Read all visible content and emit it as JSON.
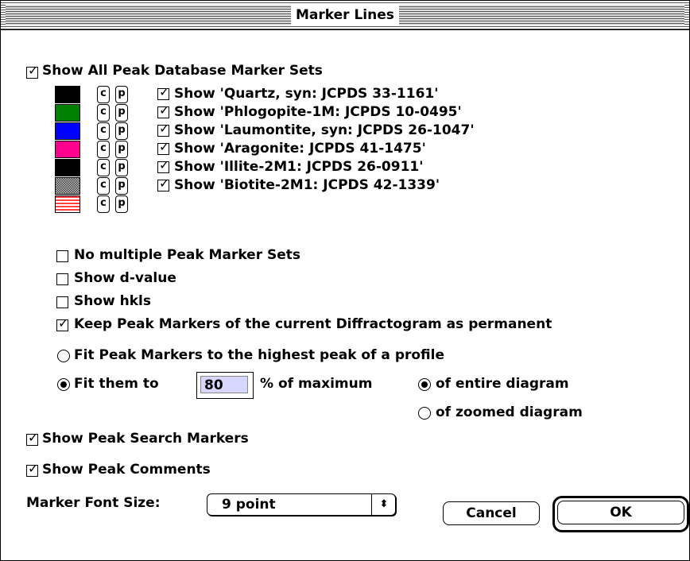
{
  "window": {
    "title": "Marker Lines"
  },
  "show_all": {
    "label": "Show All Peak Database Marker Sets",
    "checked": true
  },
  "marker_sets": [
    {
      "color": "#000000",
      "pattern": "solid",
      "checked": true,
      "label": "Show 'Quartz, syn: JCPDS 33-1161'"
    },
    {
      "color": "#008000",
      "pattern": "solid",
      "checked": true,
      "label": "Show 'Phlogopite-1M: JCPDS 10-0495'"
    },
    {
      "color": "#0000ff",
      "pattern": "solid",
      "checked": true,
      "label": "Show 'Laumontite, syn: JCPDS 26-1047'"
    },
    {
      "color": "#ff0090",
      "pattern": "solid",
      "checked": true,
      "label": "Show 'Aragonite: JCPDS 41-1475'"
    },
    {
      "color": "#000000",
      "pattern": "solid",
      "checked": true,
      "label": "Show 'Illite-2M1: JCPDS 26-0911'"
    },
    {
      "color": "#808080",
      "pattern": "dots",
      "checked": true,
      "label": "Show 'Biotite-2M1: JCPDS 42-1339'"
    },
    {
      "color": "#ff4040",
      "pattern": "stripes",
      "checked": null,
      "label": ""
    }
  ],
  "cp_labels": {
    "c": "c",
    "p": "p"
  },
  "options": [
    {
      "label": "No multiple Peak Marker Sets",
      "checked": false
    },
    {
      "label": "Show d-value",
      "checked": false
    },
    {
      "label": "Show hkls",
      "checked": false
    },
    {
      "label": "Keep Peak Markers of the current Diffractogram as permanent",
      "checked": true
    }
  ],
  "fit": {
    "highest_label": "Fit Peak Markers to the highest peak of a profile",
    "highest_selected": false,
    "fit_them_label": "Fit them to",
    "fit_them_selected": true,
    "percent_value": "80",
    "percent_suffix": "% of maximum",
    "entire_label": "of entire diagram",
    "entire_selected": true,
    "zoomed_label": "of zoomed diagram",
    "zoomed_selected": false
  },
  "show_search": {
    "label": "Show Peak Search Markers",
    "checked": true
  },
  "show_comments": {
    "label": "Show Peak Comments",
    "checked": true
  },
  "font_size": {
    "label": "Marker Font Size:",
    "value": "9 point"
  },
  "buttons": {
    "cancel": "Cancel",
    "ok": "OK"
  },
  "icons": {
    "checkmark": "☑",
    "select_arrows": "⇕"
  }
}
